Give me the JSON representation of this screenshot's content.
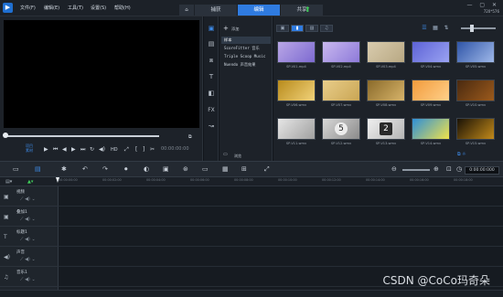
{
  "menu": [
    "文件(F)",
    "编辑(E)",
    "工具(T)",
    "设置(S)",
    "帮助(H)"
  ],
  "tabs": {
    "capture": "捕获",
    "edit": "编辑",
    "share": "共享"
  },
  "window": {
    "controls": "— ▢ ✕",
    "info": "720*576"
  },
  "player": {
    "modes": [
      "项目",
      "素材"
    ],
    "hd": "HD",
    "timecode": "00:00:00:00"
  },
  "library": {
    "add_label": "添加",
    "folders": [
      "样本",
      "ScoreFitter 音乐",
      "Triple Scoop Music",
      "Nuendo 声音效果"
    ],
    "browse_label": "浏览",
    "thumbs": [
      {
        "caption": "SP-V01.mp4",
        "colors": [
          "#b9a7e6",
          "#7d6ad1"
        ]
      },
      {
        "caption": "SP-V02.mp4",
        "colors": [
          "#c9b8ef",
          "#8d7ad9"
        ]
      },
      {
        "caption": "SP-V03.mp4",
        "colors": [
          "#d9ccae",
          "#b8a883"
        ]
      },
      {
        "caption": "SP-V04.wmv",
        "colors": [
          "#5d63d6",
          "#9aa2f2"
        ]
      },
      {
        "caption": "SP-V05.wmv",
        "colors": [
          "#2f55a8",
          "#9fb8e8"
        ]
      },
      {
        "caption": "SP-V06.wmv",
        "colors": [
          "#b88b1c",
          "#f1d27a"
        ]
      },
      {
        "caption": "SP-V07.wmv",
        "colors": [
          "#e8cd8a",
          "#caa654"
        ]
      },
      {
        "caption": "SP-V08.wmv",
        "colors": [
          "#8a6a2a",
          "#d7b46a"
        ]
      },
      {
        "caption": "SP-V09.wmv",
        "colors": [
          "#f29b3c",
          "#ffd08a"
        ]
      },
      {
        "caption": "SP-V10.wmv",
        "colors": [
          "#4a2a10",
          "#9c5a1c"
        ]
      },
      {
        "caption": "SP-V11.wmv",
        "colors": [
          "#e6e6e6",
          "#a0a0a0"
        ]
      },
      {
        "caption": "SP-V12.wmv",
        "colors": [
          "#d8d8d8",
          "#8a8a8a"
        ]
      },
      {
        "caption": "SP-V13.wmv",
        "colors": [
          "#f0f0f0",
          "#b4b4b4"
        ]
      },
      {
        "caption": "SP-V14.wmv",
        "colors": [
          "#2e8fd8",
          "#f0e24a"
        ]
      },
      {
        "caption": "SP-V15.wmv",
        "colors": [
          "#1a1206",
          "#c28a1a"
        ]
      }
    ],
    "badges": [
      "5",
      "2"
    ]
  },
  "timeline": {
    "time": "0:00:00:000",
    "ruler": [
      "00:00:00:00",
      "00:00:02:00",
      "00:00:04:00",
      "00:00:06:00",
      "00:00:08:00",
      "00:00:10:00",
      "00:00:12:00",
      "00:00:14:00",
      "00:00:16:00",
      "00:00:18:00"
    ],
    "tracks": [
      "视频",
      "叠加1",
      "标题1",
      "声音",
      "音乐1"
    ]
  },
  "watermark": "CSDN @CoCo玛奇朵"
}
